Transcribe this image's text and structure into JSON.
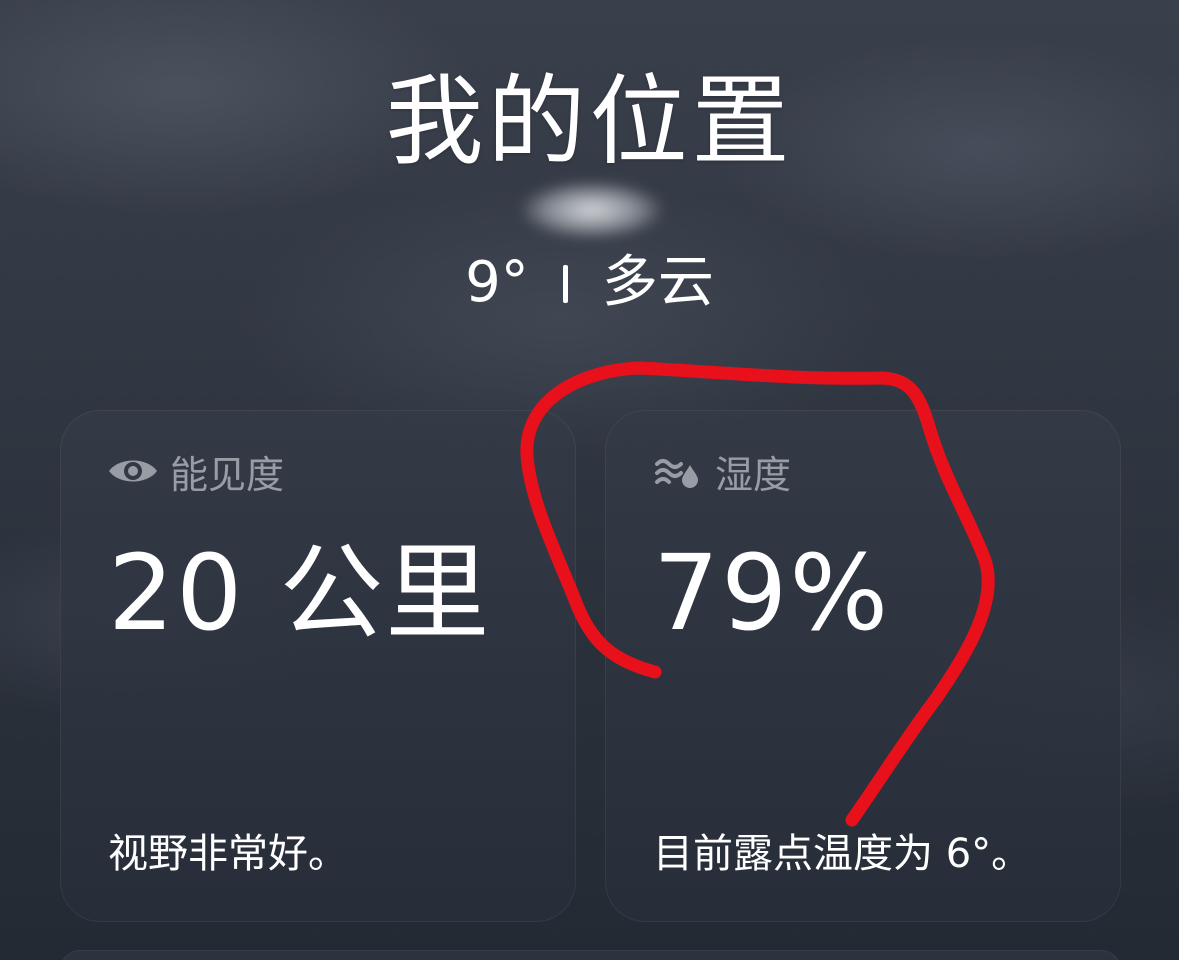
{
  "header": {
    "location_name": "我的位置",
    "temperature": "9°",
    "condition": "多云"
  },
  "visibility_card": {
    "icon": "eye-icon",
    "title": "能见度",
    "value": "20 公里",
    "description": "视野非常好。"
  },
  "humidity_card": {
    "icon": "humidity-icon",
    "title": "湿度",
    "value": "79%",
    "description": "目前露点温度为 6°。"
  },
  "colors": {
    "annotation_stroke": "#e8101a",
    "card_title": "#9aa0aa",
    "text": "#ffffff"
  }
}
